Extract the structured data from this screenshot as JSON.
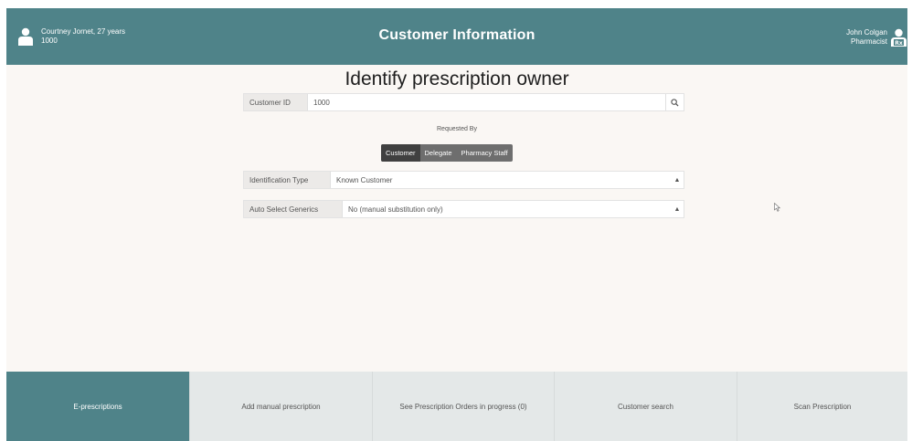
{
  "header": {
    "customer_name": "Courtney Jornet, 27 years",
    "customer_id": "1000",
    "title": "Customer Information",
    "user_name": "John Colgan",
    "user_role": "Pharmacist"
  },
  "page_title": "Identify prescription owner",
  "customer_id_field": {
    "label": "Customer ID",
    "value": "1000"
  },
  "requested_by": {
    "label": "Requested By",
    "options": [
      "Customer",
      "Delegate",
      "Pharmacy Staff"
    ],
    "selected": "Customer"
  },
  "identification_type": {
    "label": "Identification Type",
    "value": "Known Customer"
  },
  "auto_select_generics": {
    "label": "Auto Select Generics",
    "value": "No (manual substitution only)"
  },
  "footer": {
    "tabs": [
      "E-prescriptions",
      "Add manual prescription",
      "See Prescription Orders in progress (0)",
      "Customer search",
      "Scan Prescription"
    ],
    "active_tab": "E-prescriptions"
  },
  "colors": {
    "teal": "#4f8389",
    "background": "#faf7f4",
    "segment_active": "#404040"
  },
  "icons": [
    "person-icon",
    "search-icon",
    "pharmacist-icon",
    "caret-icon",
    "cursor-icon"
  ]
}
